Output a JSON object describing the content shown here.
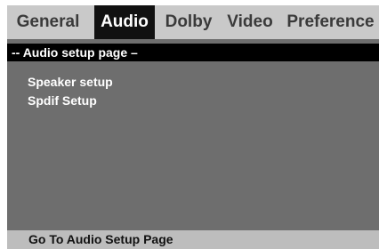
{
  "tabs": [
    {
      "label": "General",
      "active": false
    },
    {
      "label": "Audio",
      "active": true
    },
    {
      "label": "Dolby",
      "active": false
    },
    {
      "label": "Video",
      "active": false
    },
    {
      "label": "Preference",
      "active": false
    }
  ],
  "page_header": "-- Audio setup page –",
  "menu_items": [
    {
      "label": "Speaker setup"
    },
    {
      "label": "Spdif Setup"
    }
  ],
  "status_text": "Go To Audio Setup Page",
  "colors": {
    "background": "#6e6e6e",
    "tab_bar": "#c9c9c9",
    "active_tab": "#111111",
    "header_bar": "#000000",
    "status_bar": "#bdbdbd"
  }
}
